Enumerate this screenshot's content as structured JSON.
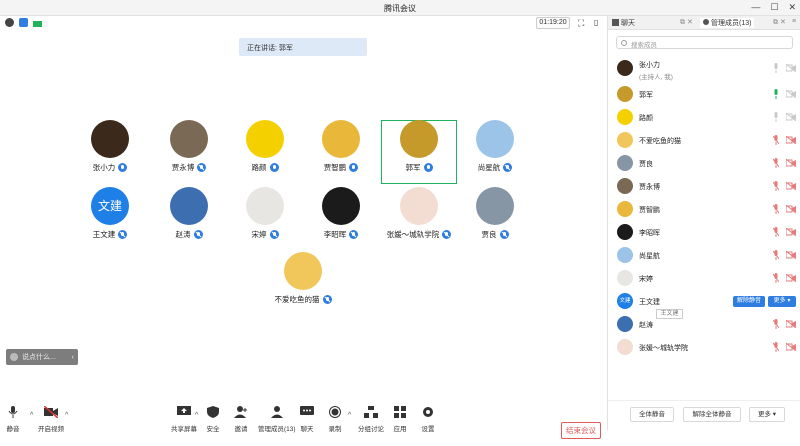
{
  "window": {
    "title": "腾讯会议"
  },
  "topbar": {
    "timer": "01:19:20"
  },
  "speaking": {
    "prefix": "正在讲话: ",
    "name": "郭军"
  },
  "gallery": [
    {
      "name": "张小力",
      "color": "#3b2a1c",
      "muted": false
    },
    {
      "name": "贾永博",
      "color": "#7a6a55",
      "muted": true
    },
    {
      "name": "路颜",
      "color": "#f5d000",
      "muted": false
    },
    {
      "name": "贾智鹏",
      "color": "#e9b83a",
      "muted": false
    },
    {
      "name": "郭军",
      "color": "#c59a2a",
      "muted": false
    },
    {
      "name": "尚星航",
      "color": "#9cc4e8",
      "muted": true
    },
    {
      "name": "王文建",
      "color": "#1e7fe6",
      "muted": true,
      "text": "文建"
    },
    {
      "name": "赵涛",
      "color": "#3d6fb0",
      "muted": true
    },
    {
      "name": "宋婷",
      "color": "#e8e6e3",
      "muted": true
    },
    {
      "name": "李昭晖",
      "color": "#1b1b1b",
      "muted": true
    },
    {
      "name": "张媛～城轨学院",
      "color": "#f3dcd1",
      "muted": true
    },
    {
      "name": "贾良",
      "color": "#8696a5",
      "muted": true
    },
    {
      "name": "不爱吃鱼的猫",
      "color": "#f1c75c",
      "muted": true
    }
  ],
  "chat_input": {
    "placeholder": "说点什么..."
  },
  "toolbar": {
    "mute": "静音",
    "video": "开启视频",
    "share": "共享屏幕",
    "security": "安全",
    "invite": "邀请",
    "members": "管理成员(13)",
    "chat": "聊天",
    "record": "录制",
    "breakout": "分组讨论",
    "apps": "应用",
    "settings": "设置",
    "end": "结束会议"
  },
  "panel": {
    "tab_chat": "聊天",
    "tab_members": "管理成员(13)",
    "search_placeholder": "搜索成员",
    "members": [
      {
        "name": "张小力",
        "sub": "(主持人, 我)",
        "color": "#3b2a1c",
        "mic": "muted-gray"
      },
      {
        "name": "郭军",
        "color": "#c59a2a",
        "mic": "active"
      },
      {
        "name": "路颜",
        "color": "#f5d000",
        "mic": "muted-gray"
      },
      {
        "name": "不爱吃鱼的猫",
        "color": "#f1c75c",
        "mic": "muted-red"
      },
      {
        "name": "贾良",
        "color": "#8696a5",
        "mic": "muted-red"
      },
      {
        "name": "贾永博",
        "color": "#7a6a55",
        "mic": "muted-red"
      },
      {
        "name": "贾智鹏",
        "color": "#e9b83a",
        "mic": "muted-red"
      },
      {
        "name": "李昭晖",
        "color": "#1b1b1b",
        "mic": "muted-red"
      },
      {
        "name": "尚星航",
        "color": "#9cc4e8",
        "mic": "muted-red"
      },
      {
        "name": "宋婷",
        "color": "#e8e6e3",
        "mic": "muted-red"
      },
      {
        "name": "王文建",
        "color": "#1e7fe6",
        "mic": "buttons",
        "text": "文建"
      },
      {
        "name": "赵涛",
        "color": "#3d6fb0",
        "mic": "muted-red"
      },
      {
        "name": "张媛～城轨学院",
        "color": "#f3dcd1",
        "mic": "muted-red"
      }
    ],
    "unmute_btn": "解除静音",
    "more_btn": "更多 ▾",
    "tooltip": "王文建",
    "mute_all": "全体静音",
    "unmute_all": "解除全体静音",
    "more": "更多 ▾"
  }
}
